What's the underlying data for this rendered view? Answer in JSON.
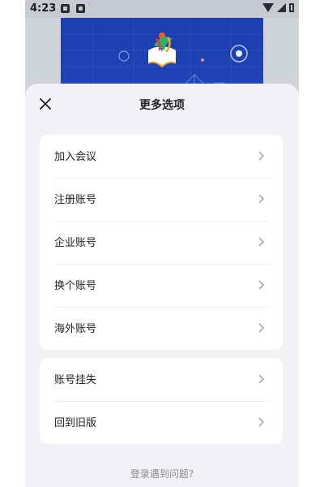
{
  "status_bar": {
    "time": "4:23",
    "icons": [
      "image-icon",
      "app-icon",
      "wifi-icon",
      "signal-icon",
      "battery-icon"
    ]
  },
  "sheet": {
    "title": "更多选项",
    "close_icon": "close-icon"
  },
  "group1": [
    {
      "label": "加入会议"
    },
    {
      "label": "注册账号"
    },
    {
      "label": "企业账号"
    },
    {
      "label": "换个账号"
    },
    {
      "label": "海外账号"
    }
  ],
  "group2": [
    {
      "label": "账号挂失"
    },
    {
      "label": "回到旧版"
    }
  ],
  "footer": {
    "help_text": "登录遇到问题?"
  },
  "colors": {
    "sheet_bg": "#f1f1f6",
    "card_bg": "#ffffff",
    "banner_blue": "#1e44b8",
    "text_primary": "#222222",
    "text_secondary": "#8a8a92"
  }
}
